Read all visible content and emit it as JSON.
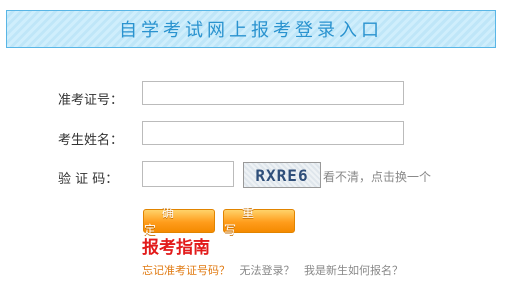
{
  "header": {
    "title": "自学考试网上报考登录入口"
  },
  "form": {
    "exam_id_label": "准考证号：",
    "exam_id_value": "",
    "name_label": "考生姓名：",
    "name_value": "",
    "captcha_label": "验 证 码：",
    "captcha_value": "",
    "captcha_image_text": "RXRE6",
    "captcha_refresh": "看不清，点击换一个"
  },
  "buttons": {
    "confirm": "确定",
    "reset": "重写"
  },
  "guide_title": "报考指南",
  "links": {
    "forgot_id": "忘记准考证号码？",
    "cannot_login": "无法登录？",
    "new_student": "我是新生如何报名？"
  },
  "colors": {
    "banner_text": "#2a93cf",
    "button": "#ff9d1c",
    "guide": "#e21b1b",
    "link_primary": "#e07a12"
  }
}
